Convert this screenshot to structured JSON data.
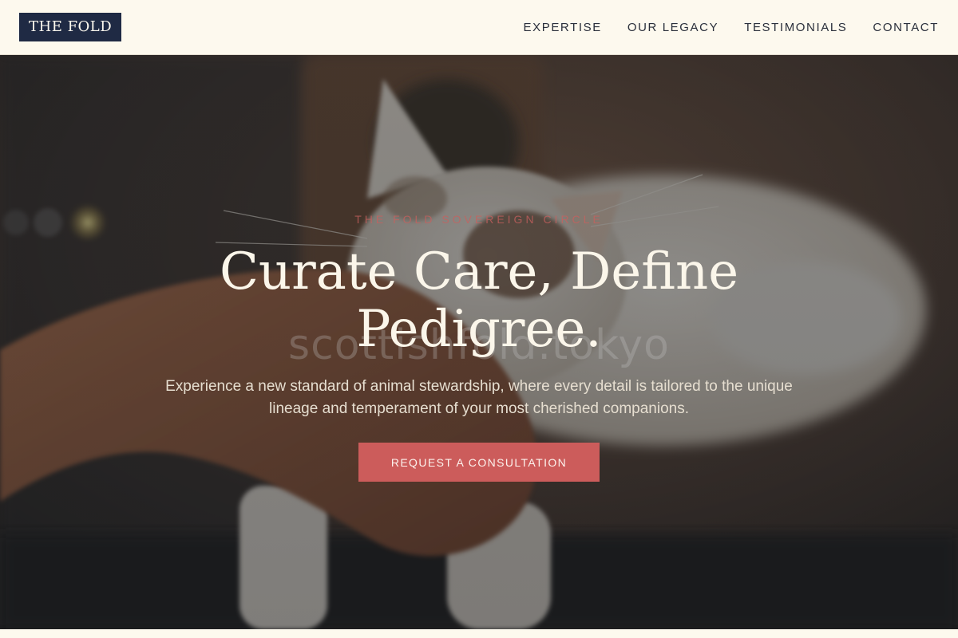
{
  "header": {
    "logo": "THE FOLD",
    "nav": [
      "EXPERTISE",
      "OUR LEGACY",
      "TESTIMONIALS",
      "CONTACT"
    ]
  },
  "hero": {
    "eyebrow": "THE FOLD SOVEREIGN CIRCLE",
    "headline_line1": "Curate Care, Define",
    "headline_line2": "Pedigree.",
    "watermark": "scottishfold.tokyo",
    "subtext": "Experience a new standard of animal stewardship, where every detail is tailored to the unique lineage and temperament of your most cherished companions.",
    "cta": "REQUEST A CONSULTATION"
  },
  "colors": {
    "header_bg": "#fdf9ee",
    "logo_bg": "#1f2a44",
    "accent": "#cc5c5b",
    "headline": "#fbf6ea"
  }
}
